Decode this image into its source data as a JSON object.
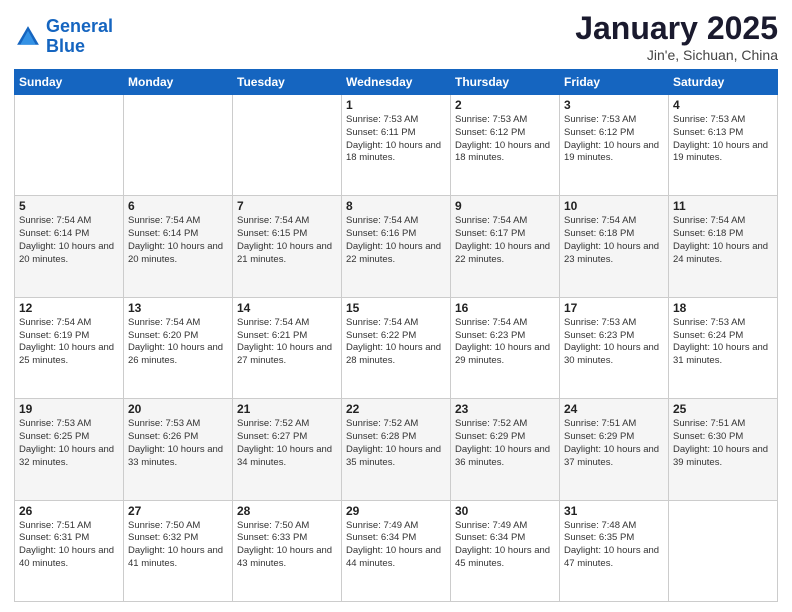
{
  "logo": {
    "line1": "General",
    "line2": "Blue"
  },
  "title": {
    "month_year": "January 2025",
    "location": "Jin'e, Sichuan, China"
  },
  "weekdays": [
    "Sunday",
    "Monday",
    "Tuesday",
    "Wednesday",
    "Thursday",
    "Friday",
    "Saturday"
  ],
  "weeks": [
    [
      {
        "day": "",
        "sunrise": "",
        "sunset": "",
        "daylight": ""
      },
      {
        "day": "",
        "sunrise": "",
        "sunset": "",
        "daylight": ""
      },
      {
        "day": "",
        "sunrise": "",
        "sunset": "",
        "daylight": ""
      },
      {
        "day": "1",
        "sunrise": "Sunrise: 7:53 AM",
        "sunset": "Sunset: 6:11 PM",
        "daylight": "Daylight: 10 hours and 18 minutes."
      },
      {
        "day": "2",
        "sunrise": "Sunrise: 7:53 AM",
        "sunset": "Sunset: 6:12 PM",
        "daylight": "Daylight: 10 hours and 18 minutes."
      },
      {
        "day": "3",
        "sunrise": "Sunrise: 7:53 AM",
        "sunset": "Sunset: 6:12 PM",
        "daylight": "Daylight: 10 hours and 19 minutes."
      },
      {
        "day": "4",
        "sunrise": "Sunrise: 7:53 AM",
        "sunset": "Sunset: 6:13 PM",
        "daylight": "Daylight: 10 hours and 19 minutes."
      }
    ],
    [
      {
        "day": "5",
        "sunrise": "Sunrise: 7:54 AM",
        "sunset": "Sunset: 6:14 PM",
        "daylight": "Daylight: 10 hours and 20 minutes."
      },
      {
        "day": "6",
        "sunrise": "Sunrise: 7:54 AM",
        "sunset": "Sunset: 6:14 PM",
        "daylight": "Daylight: 10 hours and 20 minutes."
      },
      {
        "day": "7",
        "sunrise": "Sunrise: 7:54 AM",
        "sunset": "Sunset: 6:15 PM",
        "daylight": "Daylight: 10 hours and 21 minutes."
      },
      {
        "day": "8",
        "sunrise": "Sunrise: 7:54 AM",
        "sunset": "Sunset: 6:16 PM",
        "daylight": "Daylight: 10 hours and 22 minutes."
      },
      {
        "day": "9",
        "sunrise": "Sunrise: 7:54 AM",
        "sunset": "Sunset: 6:17 PM",
        "daylight": "Daylight: 10 hours and 22 minutes."
      },
      {
        "day": "10",
        "sunrise": "Sunrise: 7:54 AM",
        "sunset": "Sunset: 6:18 PM",
        "daylight": "Daylight: 10 hours and 23 minutes."
      },
      {
        "day": "11",
        "sunrise": "Sunrise: 7:54 AM",
        "sunset": "Sunset: 6:18 PM",
        "daylight": "Daylight: 10 hours and 24 minutes."
      }
    ],
    [
      {
        "day": "12",
        "sunrise": "Sunrise: 7:54 AM",
        "sunset": "Sunset: 6:19 PM",
        "daylight": "Daylight: 10 hours and 25 minutes."
      },
      {
        "day": "13",
        "sunrise": "Sunrise: 7:54 AM",
        "sunset": "Sunset: 6:20 PM",
        "daylight": "Daylight: 10 hours and 26 minutes."
      },
      {
        "day": "14",
        "sunrise": "Sunrise: 7:54 AM",
        "sunset": "Sunset: 6:21 PM",
        "daylight": "Daylight: 10 hours and 27 minutes."
      },
      {
        "day": "15",
        "sunrise": "Sunrise: 7:54 AM",
        "sunset": "Sunset: 6:22 PM",
        "daylight": "Daylight: 10 hours and 28 minutes."
      },
      {
        "day": "16",
        "sunrise": "Sunrise: 7:54 AM",
        "sunset": "Sunset: 6:23 PM",
        "daylight": "Daylight: 10 hours and 29 minutes."
      },
      {
        "day": "17",
        "sunrise": "Sunrise: 7:53 AM",
        "sunset": "Sunset: 6:23 PM",
        "daylight": "Daylight: 10 hours and 30 minutes."
      },
      {
        "day": "18",
        "sunrise": "Sunrise: 7:53 AM",
        "sunset": "Sunset: 6:24 PM",
        "daylight": "Daylight: 10 hours and 31 minutes."
      }
    ],
    [
      {
        "day": "19",
        "sunrise": "Sunrise: 7:53 AM",
        "sunset": "Sunset: 6:25 PM",
        "daylight": "Daylight: 10 hours and 32 minutes."
      },
      {
        "day": "20",
        "sunrise": "Sunrise: 7:53 AM",
        "sunset": "Sunset: 6:26 PM",
        "daylight": "Daylight: 10 hours and 33 minutes."
      },
      {
        "day": "21",
        "sunrise": "Sunrise: 7:52 AM",
        "sunset": "Sunset: 6:27 PM",
        "daylight": "Daylight: 10 hours and 34 minutes."
      },
      {
        "day": "22",
        "sunrise": "Sunrise: 7:52 AM",
        "sunset": "Sunset: 6:28 PM",
        "daylight": "Daylight: 10 hours and 35 minutes."
      },
      {
        "day": "23",
        "sunrise": "Sunrise: 7:52 AM",
        "sunset": "Sunset: 6:29 PM",
        "daylight": "Daylight: 10 hours and 36 minutes."
      },
      {
        "day": "24",
        "sunrise": "Sunrise: 7:51 AM",
        "sunset": "Sunset: 6:29 PM",
        "daylight": "Daylight: 10 hours and 37 minutes."
      },
      {
        "day": "25",
        "sunrise": "Sunrise: 7:51 AM",
        "sunset": "Sunset: 6:30 PM",
        "daylight": "Daylight: 10 hours and 39 minutes."
      }
    ],
    [
      {
        "day": "26",
        "sunrise": "Sunrise: 7:51 AM",
        "sunset": "Sunset: 6:31 PM",
        "daylight": "Daylight: 10 hours and 40 minutes."
      },
      {
        "day": "27",
        "sunrise": "Sunrise: 7:50 AM",
        "sunset": "Sunset: 6:32 PM",
        "daylight": "Daylight: 10 hours and 41 minutes."
      },
      {
        "day": "28",
        "sunrise": "Sunrise: 7:50 AM",
        "sunset": "Sunset: 6:33 PM",
        "daylight": "Daylight: 10 hours and 43 minutes."
      },
      {
        "day": "29",
        "sunrise": "Sunrise: 7:49 AM",
        "sunset": "Sunset: 6:34 PM",
        "daylight": "Daylight: 10 hours and 44 minutes."
      },
      {
        "day": "30",
        "sunrise": "Sunrise: 7:49 AM",
        "sunset": "Sunset: 6:34 PM",
        "daylight": "Daylight: 10 hours and 45 minutes."
      },
      {
        "day": "31",
        "sunrise": "Sunrise: 7:48 AM",
        "sunset": "Sunset: 6:35 PM",
        "daylight": "Daylight: 10 hours and 47 minutes."
      },
      {
        "day": "",
        "sunrise": "",
        "sunset": "",
        "daylight": ""
      }
    ]
  ]
}
